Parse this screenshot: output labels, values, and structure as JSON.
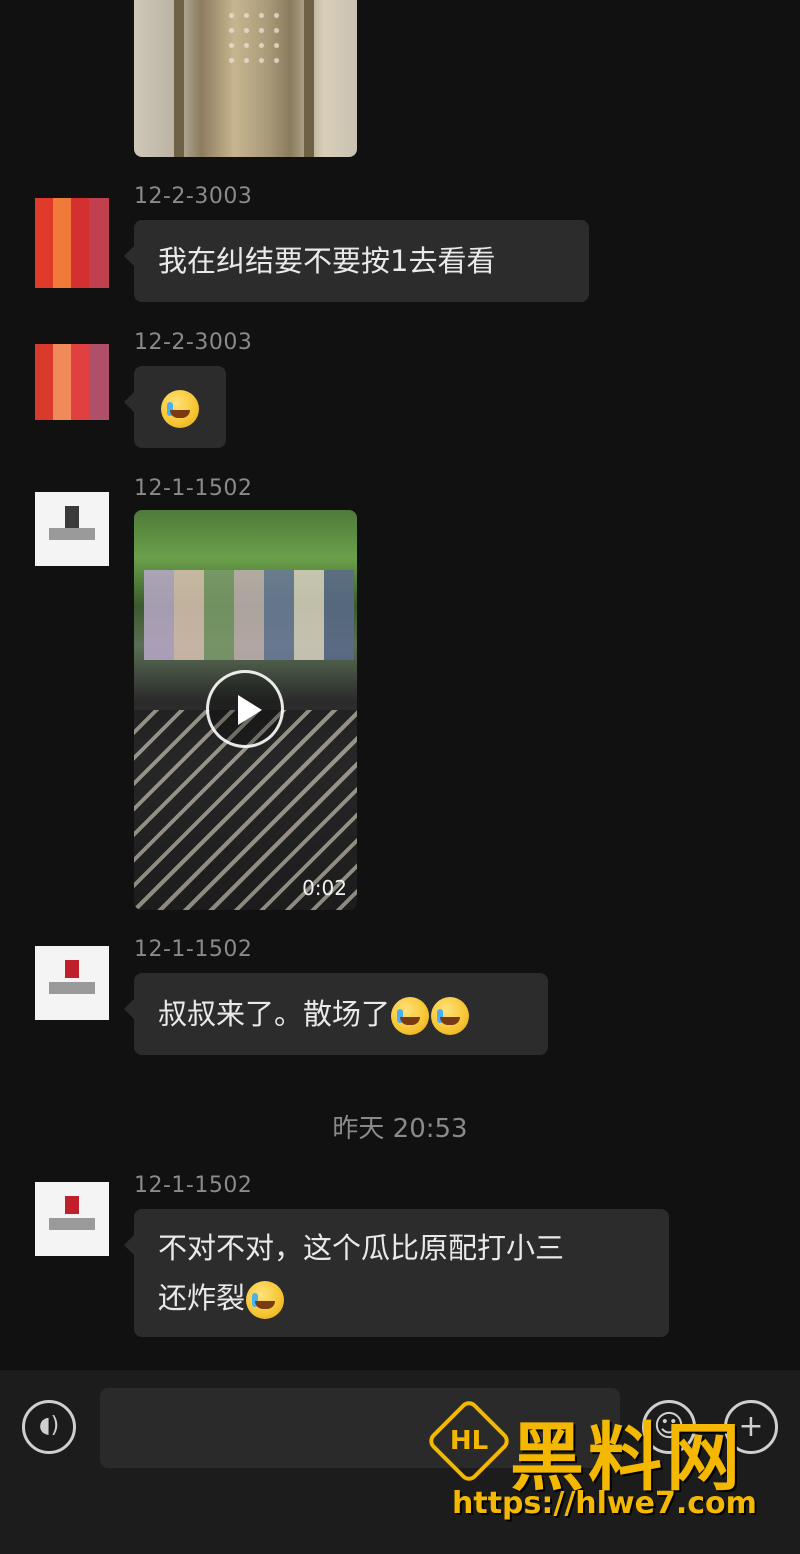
{
  "messages": [
    {
      "sender": "12-2-3003",
      "text": "我在纠结要不要按1去看看"
    },
    {
      "sender": "12-2-3003",
      "emoji": "face-with-tears-emoji"
    },
    {
      "sender": "12-1-1502",
      "video_duration": "0:02"
    },
    {
      "sender": "12-1-1502",
      "text": "叔叔来了。散场了"
    },
    {
      "sender": "12-1-1502",
      "text_line1": "不对不对，这个瓜比原配打小三",
      "text_line2": "还炸裂"
    }
  ],
  "timestamp": "昨天 20:53",
  "input": {
    "placeholder": ""
  },
  "watermark": {
    "logo_text": "HL",
    "brand": "黑料网",
    "url": "https://hlwe7.com"
  },
  "colors": {
    "background": "#111111",
    "bubble": "#2c2c2c",
    "text": "#e9e9e9",
    "muted": "#8a8a8a",
    "watermark": "#f5b800"
  }
}
